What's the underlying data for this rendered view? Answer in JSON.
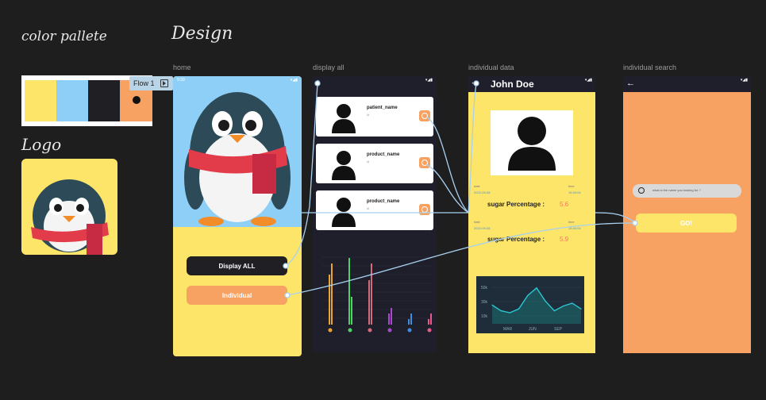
{
  "headings": {
    "palette": "color pallete",
    "design": "Design",
    "logo": "Logo"
  },
  "palette": {
    "colors": [
      "#fde56a",
      "#8ecff8",
      "#1f1f24",
      "#f7a262"
    ]
  },
  "flow": {
    "label": "Flow 1"
  },
  "frames": {
    "home": {
      "label": "home",
      "time": "9:39",
      "btn_display": "Display ALL",
      "btn_individual": "Individual"
    },
    "display_all": {
      "label": "display all",
      "items": [
        {
          "name": "patient_name",
          "sub": "id"
        },
        {
          "name": "product_name",
          "sub": "id"
        },
        {
          "name": "product_name",
          "sub": "id"
        }
      ],
      "x_icons": [
        "●",
        "●",
        "●",
        "●",
        "●",
        "●"
      ]
    },
    "individual_data": {
      "label": "individual data",
      "title": "John Doe",
      "rows": [
        {
          "date_label": "date",
          "date_value": "2022-09-08",
          "time_label": "time",
          "time_value": "15:40:04",
          "measure_label": "sugar Percentage :",
          "measure_value": "5.6"
        },
        {
          "date_label": "date",
          "date_value": "2022-09-08",
          "time_label": "time",
          "time_value": "15:40:04",
          "measure_label": "sugar Percentage :",
          "measure_value": "5.9"
        }
      ],
      "chart": {
        "y_ticks": [
          "50k",
          "30k",
          "10k"
        ],
        "x_ticks": [
          "MAR",
          "JUN",
          "SEP"
        ]
      }
    },
    "individual_search": {
      "label": "individual  search",
      "search_placeholder": "what is the name you looking for ?",
      "go": "GO!"
    }
  },
  "chart_data": [
    {
      "type": "bar",
      "title": "",
      "categories": [
        "1",
        "2",
        "3",
        "4",
        "5",
        "6"
      ],
      "series": [
        {
          "values": [
            9,
            12,
            8,
            2,
            1,
            1
          ]
        },
        {
          "values": [
            11,
            5,
            11,
            3,
            2,
            2
          ]
        }
      ],
      "colors": [
        "#e9a52d",
        "#4fd16a",
        "#d46a7a",
        "#a64ac9",
        "#3c8ee0",
        "#e85a8a"
      ]
    },
    {
      "type": "line",
      "title": "",
      "categories": [
        "MAR",
        "JUN",
        "SEP"
      ],
      "y_ticks": [
        "50k",
        "30k",
        "10k"
      ],
      "x": [
        0,
        1,
        2,
        3,
        4,
        5,
        6,
        7,
        8,
        9,
        10
      ],
      "values": [
        28,
        22,
        20,
        24,
        38,
        46,
        32,
        22,
        27,
        30,
        24
      ]
    }
  ]
}
